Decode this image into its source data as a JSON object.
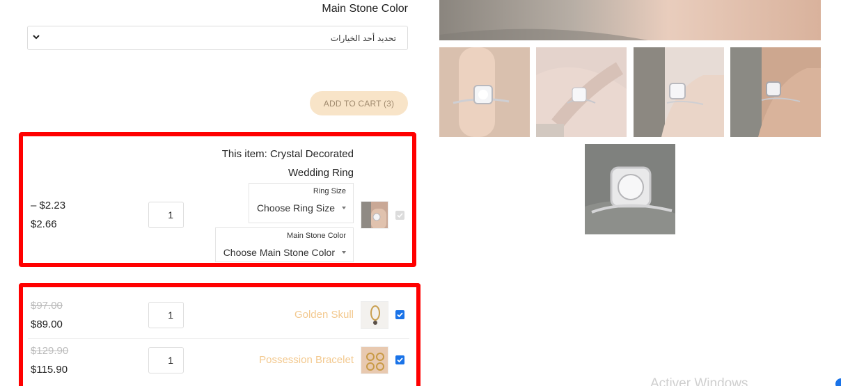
{
  "option_select": {
    "heading": "Main Stone Color",
    "value": "تحديد أحد الخيارات"
  },
  "cart": {
    "add_to_cart_label": "ADD TO CART (3)"
  },
  "bundle": {
    "main_item": {
      "title": "This item: Crystal Decorated Wedding Ring",
      "price_range_low": "– $2.23",
      "price_high": "$2.66",
      "quantity": "1",
      "ring_size_label": "Ring Size",
      "ring_size_value": "Choose Ring Size",
      "stone_color_label": "Main Stone Color",
      "stone_color_value": "Choose Main Stone Color",
      "checked": true,
      "disabled": true
    },
    "addons": [
      {
        "name": "Golden Skull",
        "old_price": "$97.00",
        "price": "$89.00",
        "quantity": "1",
        "checked": true
      },
      {
        "name": "Possession Bracelet",
        "old_price": "$129.90",
        "price": "$115.90",
        "quantity": "1",
        "checked": true
      }
    ]
  },
  "system": {
    "watermark": "Activer Windows"
  },
  "colors": {
    "highlight": "#ff0000",
    "accent_text": "#f3c98f",
    "button_bg": "#f8e4c8",
    "checkbox": "#1a73e8"
  }
}
